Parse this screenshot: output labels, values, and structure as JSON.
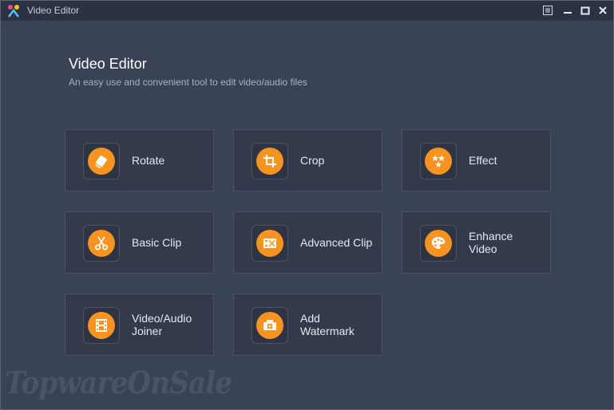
{
  "window": {
    "title": "Video Editor"
  },
  "header": {
    "title": "Video Editor",
    "subtitle": "An easy use and convenient tool to edit video/audio files"
  },
  "tools": [
    {
      "label": "Rotate",
      "icon": "rotate-icon"
    },
    {
      "label": "Crop",
      "icon": "crop-icon"
    },
    {
      "label": "Effect",
      "icon": "effect-icon"
    },
    {
      "label": "Basic Clip",
      "icon": "scissors-icon"
    },
    {
      "label": "Advanced Clip",
      "icon": "advanced-clip-icon"
    },
    {
      "label": "Enhance\nVideo",
      "icon": "palette-icon"
    },
    {
      "label": "Video/Audio\nJoiner",
      "icon": "film-icon"
    },
    {
      "label": "Add\nWatermark",
      "icon": "watermark-icon"
    }
  ],
  "watermark_text": "TopwareOnSale",
  "colors": {
    "accent": "#f7931e",
    "background": "#3a4356",
    "titlebar": "#2b3243",
    "card": "#323a4c"
  }
}
